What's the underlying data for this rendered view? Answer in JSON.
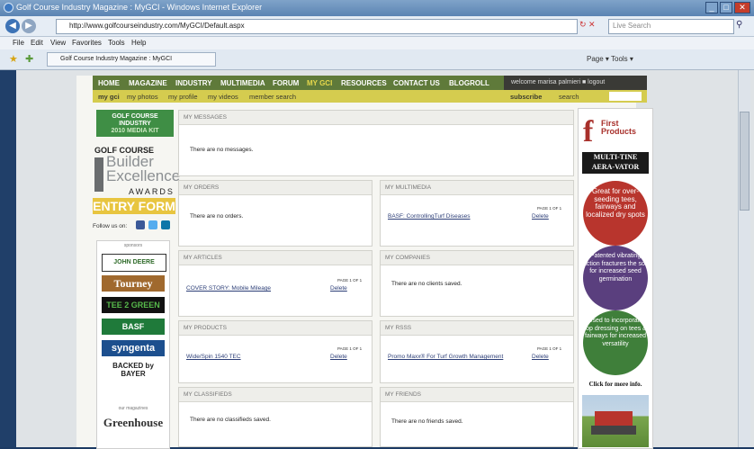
{
  "browser": {
    "title": "Golf Course Industry Magazine : MyGCI - Windows Internet Explorer",
    "url": "http://www.golfcourseindustry.com/MyGCI/Default.aspx",
    "search_placeholder": "Live Search",
    "menu": [
      "File",
      "Edit",
      "View",
      "Favorites",
      "Tools",
      "Help"
    ],
    "tab": "Golf Course Industry Magazine : MyGCI",
    "toolbar_right": "Page ▾   Tools ▾"
  },
  "topnav": {
    "items": [
      "HOME",
      "MAGAZINE",
      "INDUSTRY",
      "MULTIMEDIA",
      "FORUM",
      "MY GCI",
      "RESOURCES",
      "CONTACT US",
      "BLOGROLL"
    ],
    "welcome": "welcome  marisa palmieri  ■ logout"
  },
  "subnav": {
    "items": [
      "my gci",
      "my photos",
      "my profile",
      "my videos",
      "member search"
    ],
    "subscribe": "subscribe",
    "search": "search"
  },
  "left": {
    "mediakit": [
      "GOLF COURSE",
      "INDUSTRY",
      "2010 MEDIA KIT"
    ],
    "golf_course": "GOLF COURSE",
    "builder": [
      "Builder",
      "Excellence"
    ],
    "awards": "AWARDS",
    "entry": "ENTRY FORM",
    "follow": "Follow us on:",
    "sponsors_label": "sponsors",
    "sponsors": [
      "JOHN DEERE",
      "Tourney",
      "TEE 2 GREEN",
      "BASF",
      "syngenta",
      "BACKED by BAYER"
    ],
    "our_magazines": "our magazines",
    "greenhouse": "Greenhouse"
  },
  "panels": {
    "messages": {
      "title": "MY MESSAGES",
      "empty": "There are no messages."
    },
    "orders": {
      "title": "MY ORDERS",
      "empty": "There are no orders."
    },
    "articles": {
      "title": "MY ARTICLES",
      "page": "PAGE 1 OF 1",
      "item": "COVER STORY: Mobile Mileage",
      "delete": "Delete"
    },
    "products": {
      "title": "MY PRODUCTS",
      "page": "PAGE 1 OF 1",
      "item": "Wide/Spin 1540 TEC",
      "delete": "Delete"
    },
    "classifieds": {
      "title": "MY CLASSIFIEDS",
      "empty": "There are no classifieds saved."
    },
    "multimedia": {
      "title": "MY MULTIMEDIA",
      "page": "PAGE 1 OF 1",
      "item": "BASF: ControllingTurf Diseases",
      "delete": "Delete"
    },
    "companies": {
      "title": "MY COMPANIES",
      "empty": "There are no clients saved."
    },
    "rss": {
      "title": "MY RSSS",
      "page": "PAGE 1 OF 1",
      "item": "Promo Maxx® For Turf Growth Management",
      "delete": "Delete"
    },
    "friends": {
      "title": "MY FRIENDS",
      "empty": "There are no friends saved."
    }
  },
  "ad": {
    "brand": "First Products",
    "headline": [
      "MULTI-TINE",
      "AERA-VATOR"
    ],
    "circle1": "Great for over-seeding tees, fairways and localized dry spots",
    "circle2": "Patented vibrating action fractures the soil for increased seed germination",
    "circle3": "Used to incorporate top dressing on tees & fairways for increased versatility",
    "cta": "Click for more info.",
    "colors": {
      "red": "#b8352d",
      "purple": "#5a3f7e",
      "green": "#3f7f3a"
    }
  }
}
